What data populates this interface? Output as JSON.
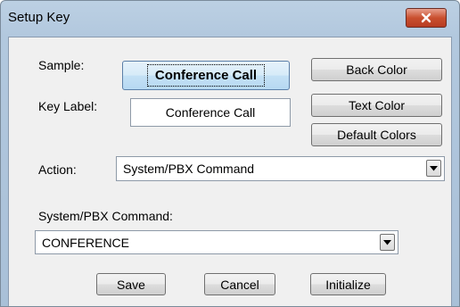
{
  "window": {
    "title": "Setup Key"
  },
  "labels": {
    "sample": "Sample:",
    "key_label": "Key Label:",
    "action": "Action:",
    "pbx_command": "System/PBX Command:"
  },
  "sample_button": {
    "text": "Conference Call"
  },
  "key_label_input": {
    "value": "Conference Call"
  },
  "color_buttons": {
    "back": "Back Color",
    "text": "Text Color",
    "default": "Default Colors"
  },
  "action_select": {
    "value": "System/PBX Command"
  },
  "pbx_select": {
    "value": "CONFERENCE"
  },
  "footer_buttons": {
    "save": "Save",
    "cancel": "Cancel",
    "initialize": "Initialize"
  },
  "icons": {
    "close": "close-icon",
    "dropdown": "chevron-down-icon"
  },
  "colors": {
    "close_button": "#c9502f",
    "title_bar": "#b2c8de",
    "dialog_background": "#f0f0f0",
    "sample_button": "#c4e1f5"
  }
}
